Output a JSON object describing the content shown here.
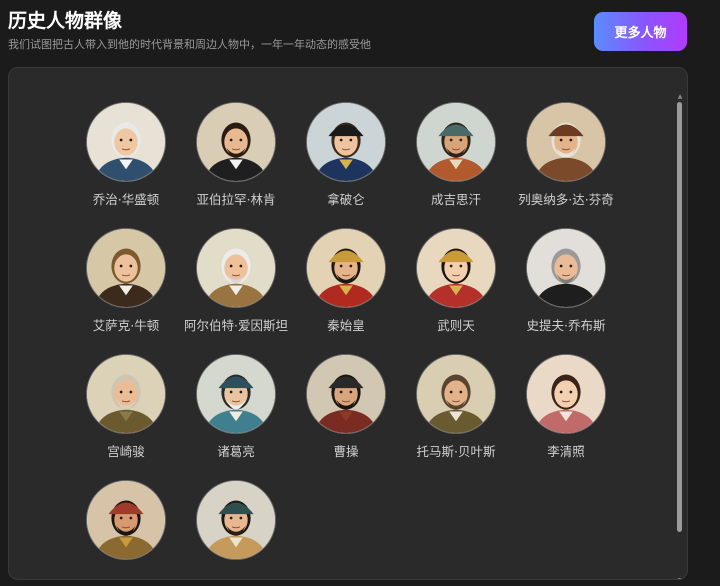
{
  "header": {
    "title": "历史人物群像",
    "subtitle": "我们试图把古人带入到他的时代背景和周边人物中，一年一年动态的感受他",
    "more_button": "更多人物"
  },
  "figures": [
    {
      "name": "乔治·华盛顿",
      "icon": "washington-portrait-icon",
      "bg": "#e8e2d6",
      "skin": "#f0c7a3",
      "hair": "#e9e9e9",
      "coat": "#2f4f6f",
      "hat": "",
      "beard": "",
      "collar": "#f4f4f4"
    },
    {
      "name": "亚伯拉罕·林肯",
      "icon": "lincoln-portrait-icon",
      "bg": "#d9cdb6",
      "skin": "#e8b990",
      "hair": "#2b1b12",
      "coat": "#1f1f1f",
      "hat": "",
      "beard": "#2b1b12",
      "collar": "#f2f2f2"
    },
    {
      "name": "拿破仑",
      "icon": "napoleon-portrait-icon",
      "bg": "#cbd4d6",
      "skin": "#efc3a0",
      "hair": "#3a2a1c",
      "coat": "#1d355e",
      "hat": "#1a1a1a",
      "beard": "",
      "collar": "#d7b14a"
    },
    {
      "name": "成吉思汗",
      "icon": "genghis-khan-portrait-icon",
      "bg": "#cfd6d0",
      "skin": "#d9a379",
      "hair": "#2d2418",
      "coat": "#b2592e",
      "hat": "#4a6a6a",
      "beard": "#2d2418",
      "collar": "#e7d9bd"
    },
    {
      "name": "列奥纳多·达·芬奇",
      "icon": "da-vinci-portrait-icon",
      "bg": "#d8c5a8",
      "skin": "#e3b48c",
      "hair": "#e6e0d5",
      "coat": "#7a4a2a",
      "hat": "#6d3a22",
      "beard": "#ebe5da",
      "collar": "#7a4a2a"
    },
    {
      "name": "艾萨克·牛顿",
      "icon": "newton-portrait-icon",
      "bg": "#d6c8a6",
      "skin": "#ecc19c",
      "hair": "#7c5a2e",
      "coat": "#3c2a1c",
      "hat": "",
      "beard": "",
      "collar": "#f2efe6"
    },
    {
      "name": "阿尔伯特·爱因斯坦",
      "icon": "einstein-portrait-icon",
      "bg": "#e2ddc9",
      "skin": "#eec19a",
      "hair": "#ececec",
      "coat": "#9a7440",
      "hat": "",
      "beard": "#d9d9d9",
      "collar": "#ededed"
    },
    {
      "name": "秦始皇",
      "icon": "qin-shi-huang-portrait-icon",
      "bg": "#e3d2b3",
      "skin": "#e5b48b",
      "hair": "#1f1712",
      "coat": "#b02a1f",
      "hat": "#c79b3a",
      "beard": "#1f1712",
      "collar": "#d9b24c"
    },
    {
      "name": "武则天",
      "icon": "wu-zetian-portrait-icon",
      "bg": "#e8d8c0",
      "skin": "#f3cfb0",
      "hair": "#1c1410",
      "coat": "#b4302a",
      "hat": "#c99a3a",
      "beard": "",
      "collar": "#d9b24c"
    },
    {
      "name": "史提夫·乔布斯",
      "icon": "steve-jobs-portrait-icon",
      "bg": "#e2dfda",
      "skin": "#e9bc97",
      "hair": "#9a9a9a",
      "coat": "#1e1e1e",
      "hat": "",
      "beard": "#7d7d7d",
      "collar": "#1e1e1e"
    },
    {
      "name": "宫崎骏",
      "icon": "miyazaki-portrait-icon",
      "bg": "#dbd2b8",
      "skin": "#ebbd95",
      "hair": "#cfc6b2",
      "coat": "#6b5a2e",
      "hat": "",
      "beard": "#d8d0bf",
      "collar": "#8a7a4a"
    },
    {
      "name": "诸葛亮",
      "icon": "zhuge-liang-portrait-icon",
      "bg": "#d4d8cf",
      "skin": "#eac4a1",
      "hair": "#2a2a2a",
      "coat": "#3f7f8f",
      "hat": "#2f4f5f",
      "beard": "#ededed",
      "collar": "#f0ece2"
    },
    {
      "name": "曹操",
      "icon": "cao-cao-portrait-icon",
      "bg": "#d2c7b2",
      "skin": "#d9a57c",
      "hair": "#1c1410",
      "coat": "#7a2c22",
      "hat": "#2a2a2a",
      "beard": "#1c1410",
      "collar": "#8a3a2a"
    },
    {
      "name": "托马斯·贝叶斯",
      "icon": "bayes-portrait-icon",
      "bg": "#d9ceb2",
      "skin": "#e2b38b",
      "hair": "#5a4430",
      "coat": "#6a5a30",
      "hat": "",
      "beard": "#5a4430",
      "collar": "#ece6d6"
    },
    {
      "name": "李清照",
      "icon": "li-qingzhao-portrait-icon",
      "bg": "#ead9c6",
      "skin": "#f3d0b2",
      "hair": "#3a2418",
      "coat": "#c06a6a",
      "hat": "",
      "beard": "",
      "collar": "#f1e4d8"
    },
    {
      "name": "",
      "icon": "warrior-portrait-icon",
      "bg": "#d7c4a8",
      "skin": "#d59a70",
      "hair": "#1c1410",
      "coat": "#8a6a30",
      "hat": "#a03a2a",
      "beard": "#1c1410",
      "collar": "#c99a3a"
    },
    {
      "name": "",
      "icon": "scholar-portrait-icon",
      "bg": "#d7d3c6",
      "skin": "#e6b791",
      "hair": "#1c1410",
      "coat": "#c69a5a",
      "hat": "#2f4f4f",
      "beard": "#2a2016",
      "collar": "#ece4d0"
    }
  ]
}
